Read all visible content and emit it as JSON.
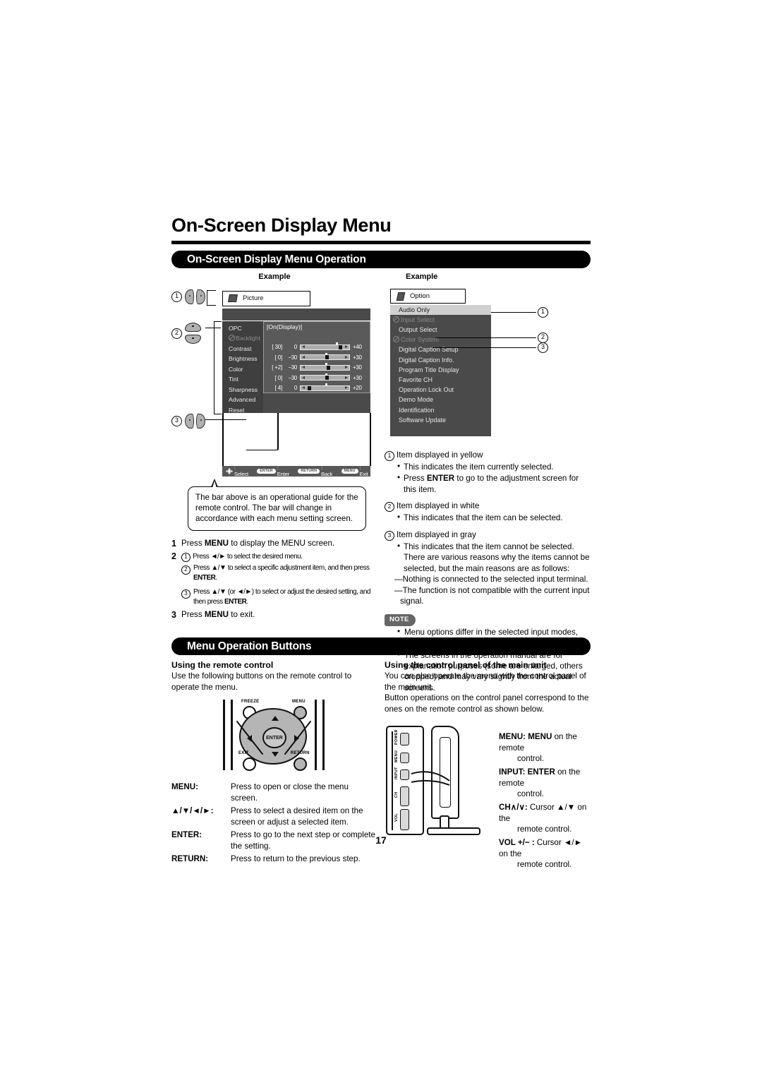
{
  "page": {
    "title": "On-Screen Display Menu",
    "number": "17"
  },
  "section1": {
    "banner": "On-Screen Display Menu Operation",
    "example_label_left": "Example",
    "example_label_right": "Example"
  },
  "picture_menu": {
    "tab_label": "Picture",
    "items": [
      {
        "label": "OPC",
        "state": "white"
      },
      {
        "label": "Backlight",
        "state": "gray"
      },
      {
        "label": "Contrast",
        "state": "white"
      },
      {
        "label": "Brightness",
        "state": "white"
      },
      {
        "label": "Color",
        "state": "white"
      },
      {
        "label": "Tint",
        "state": "white"
      },
      {
        "label": "Sharpness",
        "state": "white"
      },
      {
        "label": "Advanced",
        "state": "white"
      },
      {
        "label": "Reset",
        "state": "white"
      }
    ],
    "opc_value": "[On(Display)]",
    "sliders": [
      {
        "name": "Contrast",
        "current": "[ 30]",
        "min": "0",
        "max": "+40",
        "knob_pct": 78,
        "tick_pct": 72
      },
      {
        "name": "Brightness",
        "current": "[  0]",
        "min": "−30",
        "max": "+30",
        "knob_pct": 50,
        "tick_pct": 50
      },
      {
        "name": "Color",
        "current": "[ +2]",
        "min": "−30",
        "max": "+30",
        "knob_pct": 54,
        "tick_pct": 50
      },
      {
        "name": "Tint",
        "current": "[  0]",
        "min": "−30",
        "max": "+30",
        "knob_pct": 50,
        "tick_pct": 50
      },
      {
        "name": "Sharpness",
        "current": "[  4]",
        "min": "0",
        "max": "+20",
        "knob_pct": 14,
        "tick_pct": 50
      }
    ],
    "guide_bar": {
      "select_text": ": Select",
      "enter_key": "ENTER",
      "enter_text": ": Enter",
      "return_key": "RETURN",
      "return_text": ": Back",
      "menu_key": "MENU",
      "menu_text": ": Exit"
    }
  },
  "callout": {
    "text": "The bar above is an operational guide for the remote control. The bar will change in accordance with each menu setting screen."
  },
  "steps": [
    {
      "num": "1",
      "text_before": "Press ",
      "bold": "MENU",
      "text_after": " to display the MENU screen."
    },
    {
      "num": "2",
      "substeps": [
        {
          "marker": "1",
          "html": "Press ◄/► to select the desired menu."
        },
        {
          "marker": "2",
          "html": "Press ▲/▼ to select a specific adjustment item, and then press <b>ENTER</b>."
        },
        {
          "marker": "3",
          "html": "Press ▲/▼ (or ◄/►) to select or adjust the desired setting, and then press <b>ENTER</b>."
        }
      ]
    },
    {
      "num": "3",
      "text_before": "Press ",
      "bold": "MENU",
      "text_after": " to exit."
    }
  ],
  "option_menu": {
    "tab_label": "Option",
    "items": [
      {
        "label": "Audio Only",
        "state": "selected"
      },
      {
        "label": "Input Select",
        "state": "gray"
      },
      {
        "label": "Output Select",
        "state": "white"
      },
      {
        "label": "Color System",
        "state": "gray"
      },
      {
        "label": "Digital Caption Setup",
        "state": "white"
      },
      {
        "label": "Digital Caption Info.",
        "state": "white"
      },
      {
        "label": "Program Title Display",
        "state": "white"
      },
      {
        "label": "Favorite CH",
        "state": "white"
      },
      {
        "label": "Operation Lock Out",
        "state": "white"
      },
      {
        "label": "Demo Mode",
        "state": "white"
      },
      {
        "label": "Identification",
        "state": "white"
      },
      {
        "label": "Software Update",
        "state": "white"
      }
    ],
    "callout_numbers": [
      "1",
      "2",
      "3"
    ]
  },
  "explanations": [
    {
      "num": "1",
      "heading": "Item displayed in yellow",
      "bullets": [
        "This indicates the item currently selected.",
        "Press <b>ENTER</b> to go to the adjustment screen for this item."
      ]
    },
    {
      "num": "2",
      "heading": "Item displayed in white",
      "bullets": [
        "This indicates that the item can be selected."
      ]
    },
    {
      "num": "3",
      "heading": "Item displayed in gray",
      "bullets": [
        "This indicates that the item cannot be selected."
      ],
      "extra": "There are various reasons why the items cannot be selected, but the main reasons are as follows:",
      "dashes": [
        "—Nothing is connected to the selected input terminal.",
        "—The function is not compatible with the current input signal."
      ]
    }
  ],
  "note": {
    "badge": "NOTE",
    "items": [
      "Menu options differ in the selected input modes, but the operating procedures are the same.",
      "The screens in the operation manual are for explanation purposes (some are enlarged, others cropped) and may vary slightly from the actual screens."
    ]
  },
  "section2": {
    "banner": "Menu Operation Buttons",
    "left": {
      "heading": "Using the remote control",
      "body": "Use the following buttons on the remote control to operate the menu."
    },
    "right": {
      "heading": "Using the control panel of the main unit",
      "body1": "You can also operate the menu with the control panel of the main unit.",
      "body2": "Button operations on the control panel correspond to the ones on the remote control as shown below."
    }
  },
  "remote_diagram": {
    "freeze_label": "FREEZE",
    "menu_label": "MENU",
    "enter_label": "ENTER",
    "exit_label": "EXIT",
    "return_label": "RETURN"
  },
  "button_table": [
    {
      "key": "MENU:",
      "desc": "Press to open or close the menu screen."
    },
    {
      "key": "▲/▼/◄/►:",
      "desc": "Press to select a desired item on the screen or adjust a selected item."
    },
    {
      "key": "ENTER:",
      "desc": "Press to go to the next step or complete the setting."
    },
    {
      "key": "RETURN:",
      "desc": "Press to return to the previous step."
    }
  ],
  "tv_panel": {
    "labels": [
      "POWER",
      "MENU",
      "INPUT",
      "CH",
      "∧",
      "∨",
      "VOL",
      "+",
      "−"
    ]
  },
  "mapping": [
    {
      "bold": "MENU: MENU",
      "rest": " on the remote",
      "indent": "control."
    },
    {
      "bold": "INPUT: ENTER",
      "rest": " on the remote",
      "indent": "control."
    },
    {
      "bold": "CH∧/∨:",
      "rest": " Cursor ▲/▼ on the",
      "indent": "remote control."
    },
    {
      "bold": "VOL +/− :",
      "rest": " Cursor ◄/► on the",
      "indent": "remote control."
    }
  ]
}
